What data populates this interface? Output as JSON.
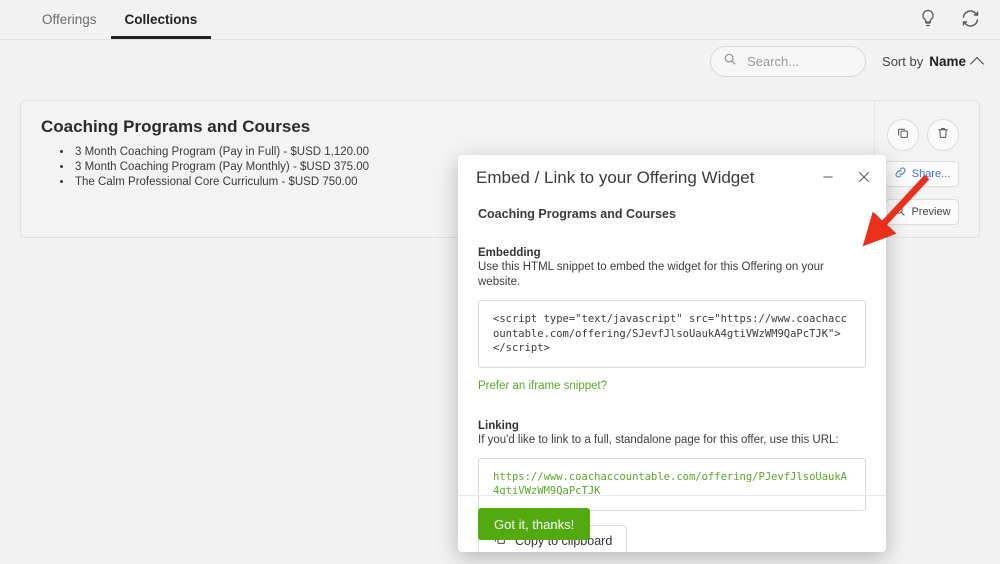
{
  "nav": {
    "tabs": [
      {
        "label": "Offerings",
        "active": false
      },
      {
        "label": "Collections",
        "active": true
      }
    ],
    "icons": [
      {
        "name": "lightbulb-icon"
      },
      {
        "name": "sync-icon"
      }
    ]
  },
  "search": {
    "placeholder": "Search...",
    "value": "",
    "icon": "search-icon"
  },
  "sort": {
    "label": "Sort by",
    "value": "Name",
    "direction_icon": "chevron-up-icon"
  },
  "collection": {
    "title": "Coaching Programs and Courses",
    "items": [
      "3 Month Coaching Program (Pay in Full) - $USD 1,120.00",
      "3 Month Coaching Program (Pay Monthly) - $USD 375.00",
      "The Calm Professional Core Curriculum - $USD 750.00"
    ],
    "actions": {
      "duplicate_icon": "copy-icon",
      "delete_icon": "trash-icon",
      "share_label": "Share...",
      "share_icon": "link-icon",
      "preview_label": "Preview",
      "preview_icon": "magnifier-icon"
    }
  },
  "modal": {
    "title": "Embed / Link to your Offering Widget",
    "minimize_icon": "minimize-icon",
    "close_icon": "close-icon",
    "subtitle": "Coaching Programs and Courses",
    "embedding": {
      "heading": "Embedding",
      "description": "Use this HTML snippet to embed the widget for this Offering on your website.",
      "code": "<script type=\"text/javascript\" src=\"https://www.coachaccountable.com/offering/SJevfJlsoUaukA4gtiVWzWM9QaPcTJK\"></script>",
      "iframe_link": "Prefer an iframe snippet?"
    },
    "linking": {
      "heading": "Linking",
      "description": "If you'd like to link to a full, standalone page for this offer, use this URL:",
      "url": "https://www.coachaccountable.com/offering/PJevfJlsoUaukA4gtiVWzWM9QaPcTJK",
      "copy_label": "Copy to clipboard",
      "copy_icon": "copy-icon"
    },
    "footer": {
      "confirm_label": "Got it, thanks!"
    }
  },
  "annotation": {
    "arrow_color": "#e8301a",
    "name": "red-arrow-annotation"
  },
  "colors": {
    "accent_green": "#52a910",
    "link_blue": "#3b6fd4",
    "page_bg": "#f2f2f2"
  }
}
